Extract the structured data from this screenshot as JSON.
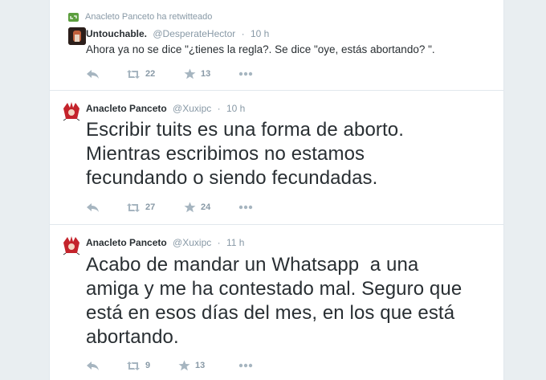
{
  "colors": {
    "accent": "#55acee",
    "retweet_green": "#5c9e3e",
    "text": "#292f33",
    "muted": "#8899a6"
  },
  "tweets": [
    {
      "retweet_context": "Anacleto Panceto ha retwitteado",
      "fullname": "Untouchable.",
      "username": "@DesperateHector",
      "separator": "·",
      "time": "10 h",
      "text": "Ahora ya no se dice \"¿tienes la regla?. Se dice \"oye, estás abortando? \".",
      "retweets": "22",
      "favorites": "13"
    },
    {
      "fullname": "Anacleto Panceto",
      "username": "@Xuxipc",
      "separator": "·",
      "time": "10 h",
      "text_lines": [
        "Escribir tuits es una forma de aborto.",
        "Mientras escribimos no estamos",
        "fecundando o siendo fecundadas."
      ],
      "retweets": "27",
      "favorites": "24"
    },
    {
      "fullname": "Anacleto Panceto",
      "username": "@Xuxipc",
      "separator": "·",
      "time": "11 h",
      "text_lines": [
        "Acabo de mandar un Whatsapp  a una",
        "amiga y me ha contestado mal. Seguro que",
        "está en esos días del mes, en los que está",
        "abortando."
      ],
      "retweets": "9",
      "favorites": "13"
    }
  ],
  "icons": {
    "reply": "reply-icon",
    "retweet": "retweet-icon",
    "favorite": "star-icon",
    "more": "more-icon"
  }
}
